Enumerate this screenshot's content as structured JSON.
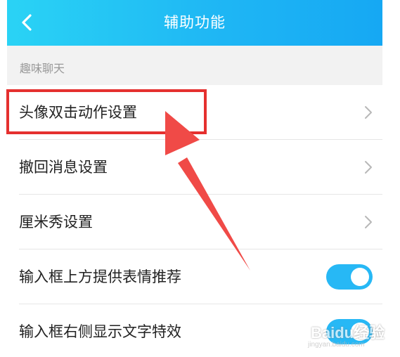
{
  "header": {
    "title": "辅助功能",
    "back_icon": "chevron-left-icon"
  },
  "section": {
    "title": "趣味聊天"
  },
  "rows": [
    {
      "label": "头像双击动作设置",
      "control": "chevron"
    },
    {
      "label": "撤回消息设置",
      "control": "chevron"
    },
    {
      "label": "厘米秀设置",
      "control": "chevron"
    },
    {
      "label": "输入框上方提供表情推荐",
      "control": "toggle",
      "toggle_on": true
    },
    {
      "label": "输入框右侧显示文字特效",
      "control": "toggle",
      "toggle_on": true
    }
  ],
  "annotation": {
    "highlight_color": "#e5302f",
    "arrow_color": "#f04a47"
  },
  "watermark": {
    "main": "Baidu经验",
    "sub": "jingyan.baidu.com"
  },
  "colors": {
    "header_start": "#2ad3f5",
    "header_end": "#16a8f3",
    "toggle_on": "#27b8f5",
    "section_bg": "#f2f2f2",
    "text_primary": "#222222",
    "text_secondary": "#999999"
  }
}
